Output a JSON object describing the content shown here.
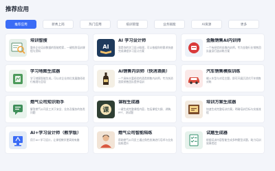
{
  "section": {
    "title": "推荐应用"
  },
  "tabs": [
    {
      "label": "推荐应用",
      "active": true
    },
    {
      "label": "新秀上岗"
    },
    {
      "label": "热门应用"
    },
    {
      "label": "培训管理"
    },
    {
      "label": "业务赋能"
    },
    {
      "label": "AI资源"
    },
    {
      "label": "更多"
    }
  ],
  "cards": [
    {
      "title": "培训智搜",
      "desc": "整合企业培训数据的智能检索，一键找到培训课程与资料",
      "icon": "magnifier-board-icon"
    },
    {
      "title": "AI 学习设计师",
      "desc": "我是你的学习设计助理，可以依据你的需求快速完成课程学习设计方案",
      "icon": "ai-book-icon"
    },
    {
      "title": "金融销售AI内训师",
      "desc": "一个有经验的金融内训师，专为金融行业销售团队量身打造训练方案",
      "icon": "finance-cards-icon"
    },
    {
      "title": "学习地图生成器",
      "desc": "学习地图智能生成，可以对企业岗位发展路径进行梳理与呈现",
      "icon": "map-figure-icon"
    },
    {
      "title": "AI销售内训师（快消酒类）",
      "desc": "一个具有丰富经验的酒类销售内训师，专为快消酒类销售团队提供培训",
      "icon": "wine-bottle-icon"
    },
    {
      "title": "汽车销售模拟训练",
      "desc": "输入车型与对话主题，即可开展沉浸式汽车销售对练",
      "icon": "car-icon"
    },
    {
      "title": "燃气公司知识助手",
      "desc": "解答燃气公司员工关于安全、业务及服务的各类问题",
      "icon": "chat-doc-icon"
    },
    {
      "title": "课程生成器",
      "desc": "一键生成完整课程内容，包括课程大纲、讲稿、PPT、测试题",
      "icon": "course-ke-icon"
    },
    {
      "title": "培训方案生成器",
      "desc": "快速生成完整培训方案，明确培训目标与实施流程",
      "icon": "plan-board-icon"
    },
    {
      "title": "AI+学习设计师（教学版）",
      "desc": "用于AI+学习设计，让课程教学更高效有趣",
      "icon": "ai-plus-icon"
    },
    {
      "title": "燃气公司智能陪练",
      "desc": "帮助燃气公司员工通过角色扮演进行话术与业务陪练提升",
      "icon": "trainer-avatar-icon"
    },
    {
      "title": "试题生成器",
      "desc": "根据培训内容智能生成多种题型试题，助力培训效果检验",
      "icon": "quiz-sheet-icon"
    }
  ]
}
